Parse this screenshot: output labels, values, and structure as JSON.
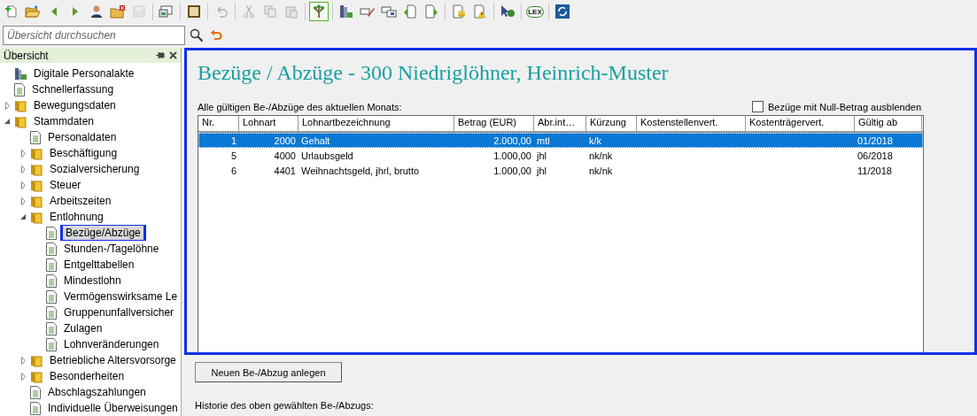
{
  "toolbar": [
    {
      "kind": "new-doc",
      "disabled": false,
      "selected": false
    },
    {
      "kind": "open-folder",
      "disabled": false,
      "selected": false
    },
    {
      "kind": "back",
      "disabled": false,
      "selected": false
    },
    {
      "kind": "forward",
      "disabled": false,
      "selected": false
    },
    {
      "kind": "person",
      "disabled": false,
      "selected": false
    },
    {
      "kind": "folder-close",
      "disabled": false,
      "selected": false
    },
    {
      "kind": "save",
      "disabled": true,
      "selected": false
    },
    {
      "kind": "sep"
    },
    {
      "kind": "screen",
      "disabled": false,
      "selected": false
    },
    {
      "kind": "sep"
    },
    {
      "kind": "frame",
      "disabled": false,
      "selected": false
    },
    {
      "kind": "sep"
    },
    {
      "kind": "undo",
      "disabled": true,
      "selected": false
    },
    {
      "kind": "sep"
    },
    {
      "kind": "cut",
      "disabled": true,
      "selected": false
    },
    {
      "kind": "copy",
      "disabled": true,
      "selected": false
    },
    {
      "kind": "paste",
      "disabled": true,
      "selected": false
    },
    {
      "kind": "sep"
    },
    {
      "kind": "tree",
      "disabled": false,
      "selected": true
    },
    {
      "kind": "sep"
    },
    {
      "kind": "binder",
      "disabled": false,
      "selected": false
    },
    {
      "kind": "pencil",
      "disabled": false,
      "selected": false
    },
    {
      "kind": "card",
      "disabled": false,
      "selected": false
    },
    {
      "kind": "doc-left",
      "disabled": false,
      "selected": false
    },
    {
      "kind": "doc-right",
      "disabled": false,
      "selected": false
    },
    {
      "kind": "sep"
    },
    {
      "kind": "coins",
      "disabled": false,
      "selected": false
    },
    {
      "kind": "alert-doc",
      "disabled": false,
      "selected": false
    },
    {
      "kind": "sep"
    },
    {
      "kind": "help",
      "disabled": false,
      "selected": false
    },
    {
      "kind": "sep"
    },
    {
      "kind": "lex",
      "label": "LEX",
      "disabled": false,
      "selected": false
    },
    {
      "kind": "sep"
    },
    {
      "kind": "refresh",
      "disabled": false,
      "selected": false
    }
  ],
  "search": {
    "placeholder": "Übersicht durchsuchen"
  },
  "sidebar": {
    "title": "Übersicht",
    "items": [
      {
        "label": "Digitale Personalakte",
        "kind": "binder",
        "selected": false
      },
      {
        "label": "Schnellerfassung",
        "kind": "page",
        "selected": false
      },
      {
        "label": "Bewegungsdaten",
        "kind": "folder",
        "expanded": false,
        "selected": false
      },
      {
        "label": "Stammdaten",
        "kind": "folder",
        "expanded": true,
        "selected": false,
        "children": [
          {
            "label": "Personaldaten",
            "kind": "page",
            "selected": false
          },
          {
            "label": "Beschäftigung",
            "kind": "folder",
            "expanded": false,
            "selected": false
          },
          {
            "label": "Sozialversicherung",
            "kind": "folder",
            "expanded": false,
            "selected": false
          },
          {
            "label": "Steuer",
            "kind": "folder",
            "expanded": false,
            "selected": false
          },
          {
            "label": "Arbeitszeiten",
            "kind": "folder",
            "expanded": false,
            "selected": false
          },
          {
            "label": "Entlohnung",
            "kind": "folder",
            "expanded": true,
            "selected": false,
            "children": [
              {
                "label": "Bezüge/Abzüge",
                "kind": "page",
                "selected": true
              },
              {
                "label": "Stunden-/Tagelöhne",
                "kind": "page",
                "selected": false
              },
              {
                "label": "Entgelttabellen",
                "kind": "page",
                "selected": false
              },
              {
                "label": "Mindestlohn",
                "kind": "page",
                "selected": false
              },
              {
                "label": "Vermögenswirksame Le",
                "kind": "page",
                "selected": false
              },
              {
                "label": "Gruppenunfallversicher",
                "kind": "page",
                "selected": false
              },
              {
                "label": "Zulagen",
                "kind": "page",
                "selected": false
              },
              {
                "label": "Lohnveränderungen",
                "kind": "page",
                "selected": false
              }
            ]
          },
          {
            "label": "Betriebliche Altersvorsorge",
            "kind": "folder",
            "expanded": false,
            "selected": false
          },
          {
            "label": "Besonderheiten",
            "kind": "folder",
            "expanded": false,
            "selected": false
          },
          {
            "label": "Abschlagszahlungen",
            "kind": "page",
            "selected": false
          },
          {
            "label": "Individuelle Überweisungen",
            "kind": "page",
            "selected": false
          }
        ]
      }
    ]
  },
  "main": {
    "title": "Bezüge / Abzüge - 300 Niedriglöhner, Heinrich-Muster",
    "table_caption": "Alle gültigen Be-/Abzüge des aktuellen Monats:",
    "hide_zero": {
      "label": "Bezüge mit Null-Betrag ausblenden",
      "checked": false
    },
    "table": {
      "columns": [
        "Nr.",
        "Lohnart",
        "Lohnartbezeichnung",
        "Betrag (EUR)",
        "Abr.int…",
        "Kürzung",
        "Kostenstellenvert.",
        "Kostenträgervert.",
        "Gültig ab"
      ],
      "rows": [
        {
          "cells": [
            "1",
            "2000",
            "Gehalt",
            "2.000,00",
            "mtl",
            "k/k",
            "",
            "",
            "01/2018"
          ],
          "selected": true
        },
        {
          "cells": [
            "5",
            "4000",
            "Urlaubsgeld",
            "1.000,00",
            "jhl",
            "nk/nk",
            "",
            "",
            "06/2018"
          ],
          "selected": false
        },
        {
          "cells": [
            "6",
            "4401",
            "Weihnachtsgeld, jhrl, brutto",
            "1.000,00",
            "jhl",
            "nk/nk",
            "",
            "",
            "11/2018"
          ],
          "selected": false
        }
      ]
    },
    "new_button": "Neuen Be-/Abzug anlegen",
    "history_caption": "Historie des oben gewählten Be-/Abzugs:"
  }
}
